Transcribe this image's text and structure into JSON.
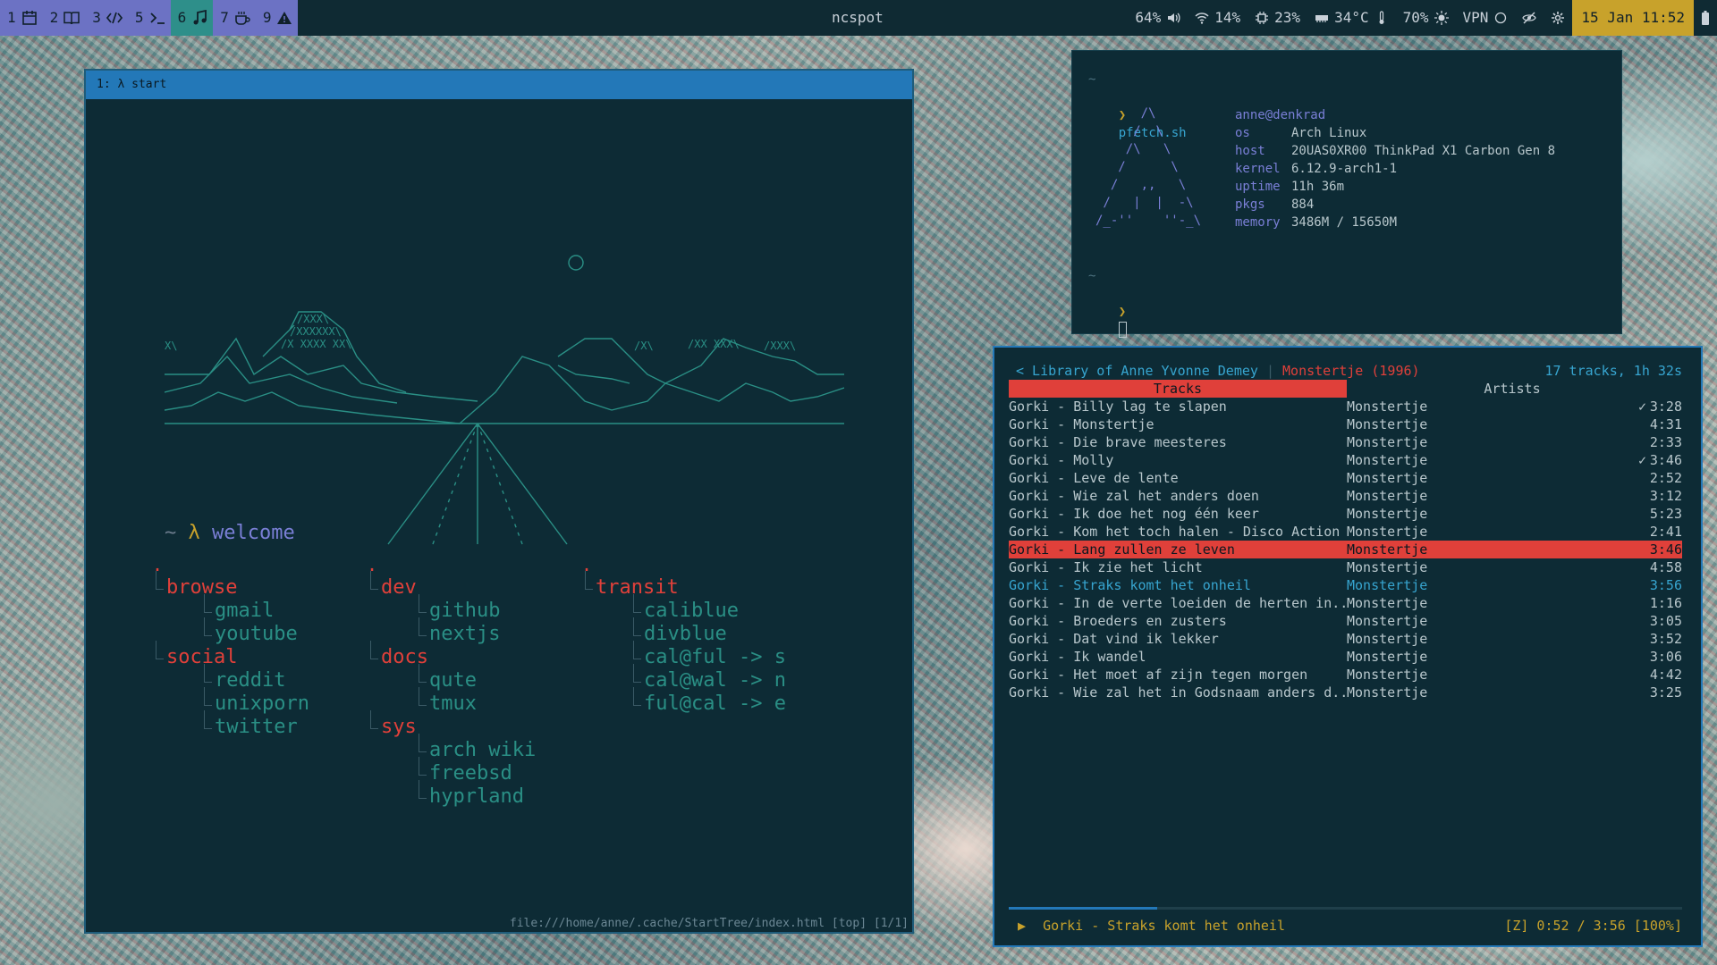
{
  "topbar": {
    "workspaces": [
      {
        "num": "1",
        "icon": "calendar-icon",
        "active": false
      },
      {
        "num": "2",
        "icon": "book-icon",
        "active": false
      },
      {
        "num": "3",
        "icon": "code-icon",
        "active": false
      },
      {
        "num": "5",
        "icon": "terminal-icon",
        "active": false
      },
      {
        "num": "6",
        "icon": "music-icon",
        "active": true
      },
      {
        "num": "7",
        "icon": "coffee-icon",
        "active": false
      },
      {
        "num": "9",
        "icon": "warning-icon",
        "active": false
      }
    ],
    "title": "ncspot",
    "volume": "64%",
    "wifi": "14%",
    "cpu": "23%",
    "temperature": "34°C",
    "brightness": "70%",
    "vpn": "VPN",
    "clock": "15 Jan 11:52",
    "colors": {
      "bar_bg": "#0f2a33",
      "ws_bg": "#6c72c4",
      "ws_active": "#2e8f8a",
      "clock_bg": "#c8a22b"
    }
  },
  "browser": {
    "tab_title": "1: λ start",
    "welcome_tilde": "~",
    "welcome_lambda": "λ",
    "welcome_word": "welcome",
    "columns": [
      {
        "groups": [
          {
            "category": "browse",
            "links": [
              "gmail",
              "youtube"
            ]
          },
          {
            "category": "social",
            "links": [
              "reddit",
              "unixporn",
              "twitter"
            ]
          }
        ]
      },
      {
        "groups": [
          {
            "category": "dev",
            "links": [
              "github",
              "nextjs"
            ]
          },
          {
            "category": "docs",
            "links": [
              "qute",
              "tmux"
            ]
          },
          {
            "category": "sys",
            "links": [
              "arch wiki",
              "freebsd",
              "hyprland"
            ]
          }
        ]
      },
      {
        "groups": [
          {
            "category": "transit",
            "links": [
              "caliblue",
              "divblue",
              "cal@ful -> s",
              "cal@wal -> n",
              "ful@cal -> e"
            ]
          }
        ]
      }
    ],
    "statusline": "file:///home/anne/.cache/StartTree/index.html [top] [1/1]"
  },
  "terminal": {
    "tilde1": "~",
    "prompt": "❯",
    "command": "pfetch.sh",
    "user": "anne@denkrad",
    "info": [
      {
        "key": "os",
        "value": "Arch Linux"
      },
      {
        "key": "host",
        "value": "20UAS0XR00 ThinkPad X1 Carbon Gen 8"
      },
      {
        "key": "kernel",
        "value": "6.12.9-arch1-1"
      },
      {
        "key": "uptime",
        "value": "11h 36m"
      },
      {
        "key": "pkgs",
        "value": "884"
      },
      {
        "key": "memory",
        "value": "3486M / 15650M"
      }
    ],
    "tilde2": "~",
    "prompt2": "❯"
  },
  "ncspot": {
    "back": "< Library of Anne Yvonne Demey",
    "sep": "|",
    "album": "Monstertje (1996)",
    "summary": "17 tracks, 1h 32s",
    "tabs": [
      "Tracks",
      "Artists"
    ],
    "tracks": [
      {
        "title": "Gorki - Billy lag te slapen",
        "album": "Monstertje",
        "check": "✓",
        "duration": "3:28"
      },
      {
        "title": "Gorki - Monstertje",
        "album": "Monstertje",
        "check": "",
        "duration": "4:31"
      },
      {
        "title": "Gorki - Die brave meesteres",
        "album": "Monstertje",
        "check": "",
        "duration": "2:33"
      },
      {
        "title": "Gorki - Molly",
        "album": "Monstertje",
        "check": "✓",
        "duration": "3:46"
      },
      {
        "title": "Gorki - Leve de lente",
        "album": "Monstertje",
        "check": "",
        "duration": "2:52"
      },
      {
        "title": "Gorki - Wie zal het anders doen",
        "album": "Monstertje",
        "check": "",
        "duration": "3:12"
      },
      {
        "title": "Gorki - Ik doe het nog één keer",
        "album": "Monstertje",
        "check": "",
        "duration": "5:23"
      },
      {
        "title": "Gorki - Kom het toch halen - Disco Action",
        "album": "Monstertje",
        "check": "",
        "duration": "2:41"
      },
      {
        "title": "Gorki - Lang zullen ze leven",
        "album": "Monstertje",
        "check": "",
        "duration": "3:46",
        "state": "selected"
      },
      {
        "title": "Gorki - Ik zie het licht",
        "album": "Monstertje",
        "check": "",
        "duration": "4:58"
      },
      {
        "title": "Gorki - Straks komt het onheil",
        "album": "Monstertje",
        "check": "",
        "duration": "3:56",
        "state": "playing"
      },
      {
        "title": "Gorki - In de verte loeiden de herten in..",
        "album": "Monstertje",
        "check": "",
        "duration": "1:16"
      },
      {
        "title": "Gorki - Broeders en zusters",
        "album": "Monstertje",
        "check": "",
        "duration": "3:05"
      },
      {
        "title": "Gorki - Dat vind ik lekker",
        "album": "Monstertje",
        "check": "",
        "duration": "3:52"
      },
      {
        "title": "Gorki - Ik wandel",
        "album": "Monstertje",
        "check": "",
        "duration": "3:06"
      },
      {
        "title": "Gorki - Het moet af zijn tegen morgen",
        "album": "Monstertje",
        "check": "",
        "duration": "4:42"
      },
      {
        "title": "Gorki - Wie zal het in Godsnaam anders d..",
        "album": "Monstertje",
        "check": "",
        "duration": "3:25"
      }
    ],
    "progress_fraction": 0.22,
    "now_playing_icon": "▶",
    "now_playing": "Gorki - Straks komt het onheil",
    "now_status": "[Z] 0:52 / 3:56 [100%]",
    "colors": {
      "accent_red": "#e0403a",
      "accent_blue": "#37a5d0",
      "accent_yellow": "#c8a22b"
    }
  }
}
